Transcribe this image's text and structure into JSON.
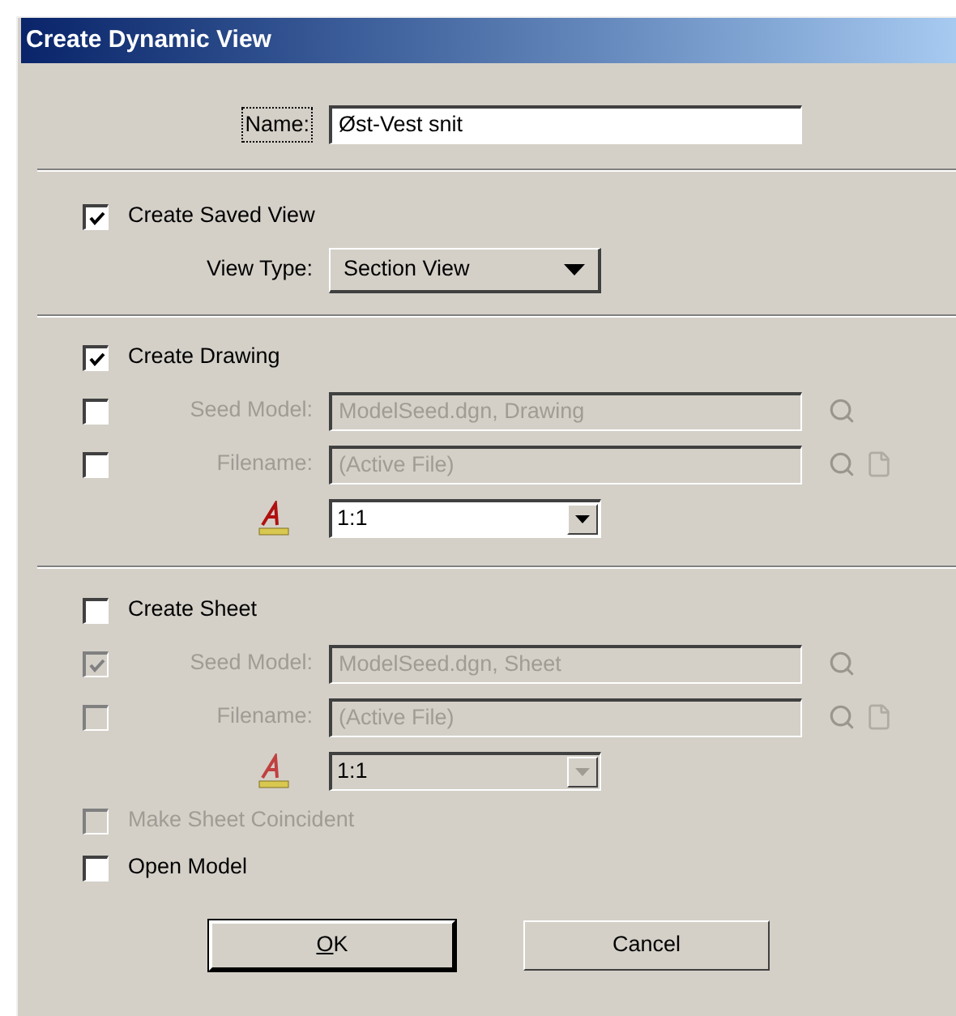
{
  "window": {
    "title": "Create Dynamic View"
  },
  "name_field": {
    "label": "Name:",
    "focused": true,
    "value": "Øst-Vest snit"
  },
  "saved_view": {
    "checkbox": {
      "label": "Create Saved View",
      "checked": true,
      "disabled": false
    },
    "view_type": {
      "label": "View Type:",
      "value": "Section View"
    }
  },
  "drawing": {
    "checkbox": {
      "label": "Create Drawing",
      "checked": true,
      "disabled": false
    },
    "rows": [
      {
        "kind": "file",
        "checkbox": {
          "checked": false,
          "disabled": false
        },
        "label": "Seed Model:",
        "value": "ModelSeed.dgn, Drawing",
        "disabled": true,
        "buttons": [
          {
            "kind": "browse"
          }
        ]
      },
      {
        "kind": "file",
        "checkbox": {
          "checked": false,
          "disabled": false
        },
        "label": "Filename:",
        "value": "(Active File)",
        "disabled": true,
        "buttons": [
          {
            "kind": "browse"
          },
          {
            "kind": "new"
          }
        ]
      },
      {
        "kind": "scale",
        "value": "1:1",
        "disabled": false
      }
    ]
  },
  "sheet": {
    "checkbox": {
      "label": "Create Sheet",
      "checked": false,
      "disabled": false
    },
    "rows": [
      {
        "kind": "file",
        "checkbox": {
          "checked": true,
          "disabled": true
        },
        "label": "Seed Model:",
        "value": "ModelSeed.dgn, Sheet",
        "disabled": true,
        "buttons": [
          {
            "kind": "browse"
          }
        ]
      },
      {
        "kind": "file",
        "checkbox": {
          "checked": false,
          "disabled": true
        },
        "label": "Filename:",
        "value": "(Active File)",
        "disabled": true,
        "buttons": [
          {
            "kind": "browse"
          },
          {
            "kind": "new"
          }
        ]
      },
      {
        "kind": "scale",
        "value": "1:1",
        "disabled": true
      }
    ]
  },
  "options": [
    {
      "label": "Make Sheet Coincident",
      "checked": false,
      "disabled": true
    },
    {
      "label": "Open Model",
      "checked": false,
      "disabled": false
    }
  ],
  "buttons": [
    {
      "label": "OK",
      "default": true,
      "underline_first": true
    },
    {
      "label": "Cancel",
      "default": false,
      "underline_first": false
    }
  ]
}
